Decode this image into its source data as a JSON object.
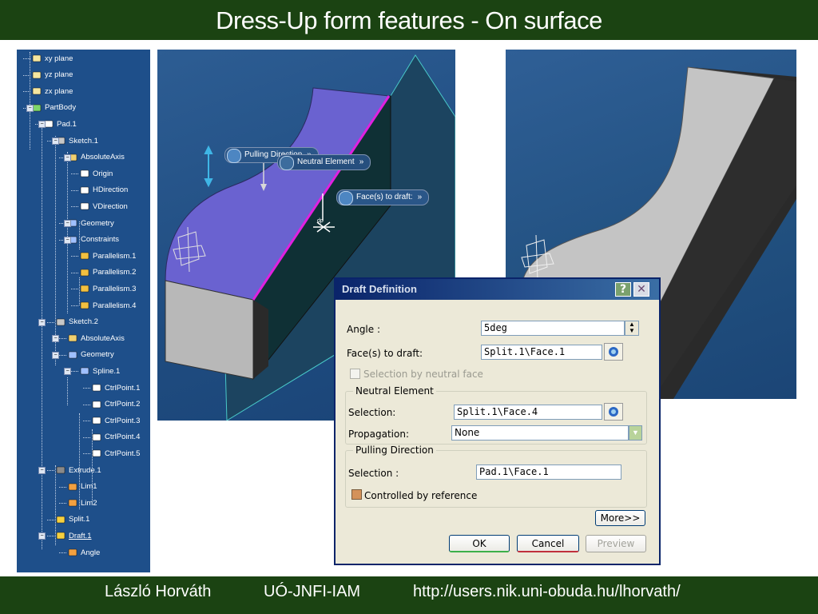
{
  "header": {
    "title": "Dress-Up form features - On surface"
  },
  "footer": {
    "author": "László Horváth",
    "institute": "UÓ-JNFI-IAM",
    "url": "http://users.nik.uni-obuda.hu/lhorvath/"
  },
  "tree": {
    "items": [
      {
        "label": "xy plane"
      },
      {
        "label": "yz plane"
      },
      {
        "label": "zx plane"
      },
      {
        "label": "PartBody"
      },
      {
        "label": "Pad.1"
      },
      {
        "label": "Sketch.1"
      },
      {
        "label": "AbsoluteAxis"
      },
      {
        "label": "Origin"
      },
      {
        "label": "HDirection"
      },
      {
        "label": "VDirection"
      },
      {
        "label": "Geometry"
      },
      {
        "label": "Constraints"
      },
      {
        "label": "Parallelism.1"
      },
      {
        "label": "Parallelism.2"
      },
      {
        "label": "Parallelism.3"
      },
      {
        "label": "Parallelism.4"
      },
      {
        "label": "Sketch.2"
      },
      {
        "label": "AbsoluteAxis"
      },
      {
        "label": "Geometry"
      },
      {
        "label": "Spline.1"
      },
      {
        "label": "CtrlPoint.1"
      },
      {
        "label": "CtrlPoint.2"
      },
      {
        "label": "CtrlPoint.3"
      },
      {
        "label": "CtrlPoint.4"
      },
      {
        "label": "CtrlPoint.5"
      },
      {
        "label": "Extrude.1"
      },
      {
        "label": "Lim1"
      },
      {
        "label": "Lim2"
      },
      {
        "label": "Split.1"
      },
      {
        "label": "Draft.1"
      },
      {
        "label": "Angle"
      }
    ]
  },
  "viewport": {
    "tags": {
      "pulling_direction": "Pulling Direction",
      "neutral_element": "Neutral Element",
      "faces_to_draft": "Face(s) to draft:",
      "chevron": "»"
    },
    "small_label": "dp"
  },
  "dialog": {
    "title": "Draft Definition",
    "help_btn": "?",
    "close_btn": "✕",
    "angle_label": "Angle :",
    "angle_value": "5deg",
    "faces_label": "Face(s) to draft:",
    "faces_value": "Split.1\\Face.1",
    "selection_by_neutral_face": "Selection by neutral face",
    "neutral_group": "Neutral Element",
    "neutral_selection_label": "Selection:",
    "neutral_selection_value": "Split.1\\Face.4",
    "propagation_label": "Propagation:",
    "propagation_value": "None",
    "pulling_group": "Pulling Direction",
    "pulling_selection_label": "Selection :",
    "pulling_selection_value": "Pad.1\\Face.1",
    "controlled_by_reference": "Controlled by reference",
    "more_btn": "More>>",
    "ok_btn": "OK",
    "cancel_btn": "Cancel",
    "preview_btn": "Preview"
  },
  "colors": {
    "header_bg": "#1b4312",
    "tree_bg": "#1e4f8a",
    "face_violet": "#6a62d0",
    "edge_magenta": "#e020e0"
  }
}
